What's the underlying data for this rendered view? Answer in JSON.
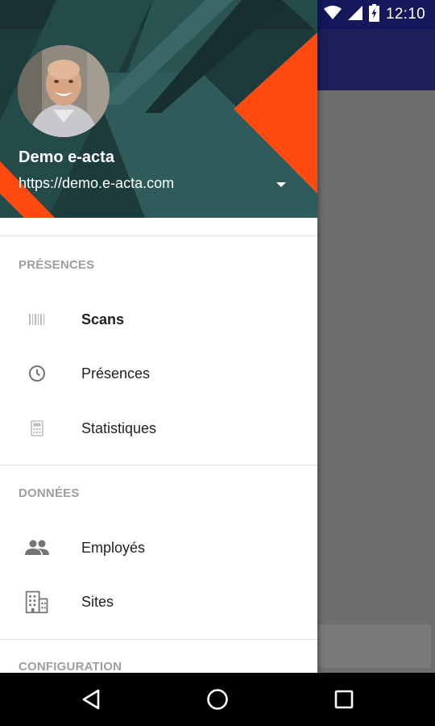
{
  "status_bar": {
    "time": "12:10",
    "icons": [
      "wifi-icon",
      "cell-signal-icon",
      "battery-charging-icon"
    ]
  },
  "drawer": {
    "header": {
      "account_name": "Demo e-acta",
      "account_url": "https://demo.e-acta.com"
    },
    "sections": [
      {
        "label": "PRÉSENCES",
        "items": [
          {
            "label": "Scans",
            "icon": "barcode-icon",
            "active": true
          },
          {
            "label": "Présences",
            "icon": "clock-icon",
            "active": false
          },
          {
            "label": "Statistiques",
            "icon": "calculator-icon",
            "active": false
          }
        ]
      },
      {
        "label": "DONNÉES",
        "items": [
          {
            "label": "Employés",
            "icon": "people-icon",
            "active": false
          },
          {
            "label": "Sites",
            "icon": "building-icon",
            "active": false
          }
        ]
      },
      {
        "label": "CONFIGURATION",
        "items": []
      }
    ]
  },
  "colors": {
    "header_bg": "#1d3b3a",
    "header_accent": "#ff4a12",
    "app_bar": "#1c1f5c",
    "section_label": "#9e9e9e"
  },
  "system_nav": [
    "back-icon",
    "home-icon",
    "recents-icon"
  ]
}
